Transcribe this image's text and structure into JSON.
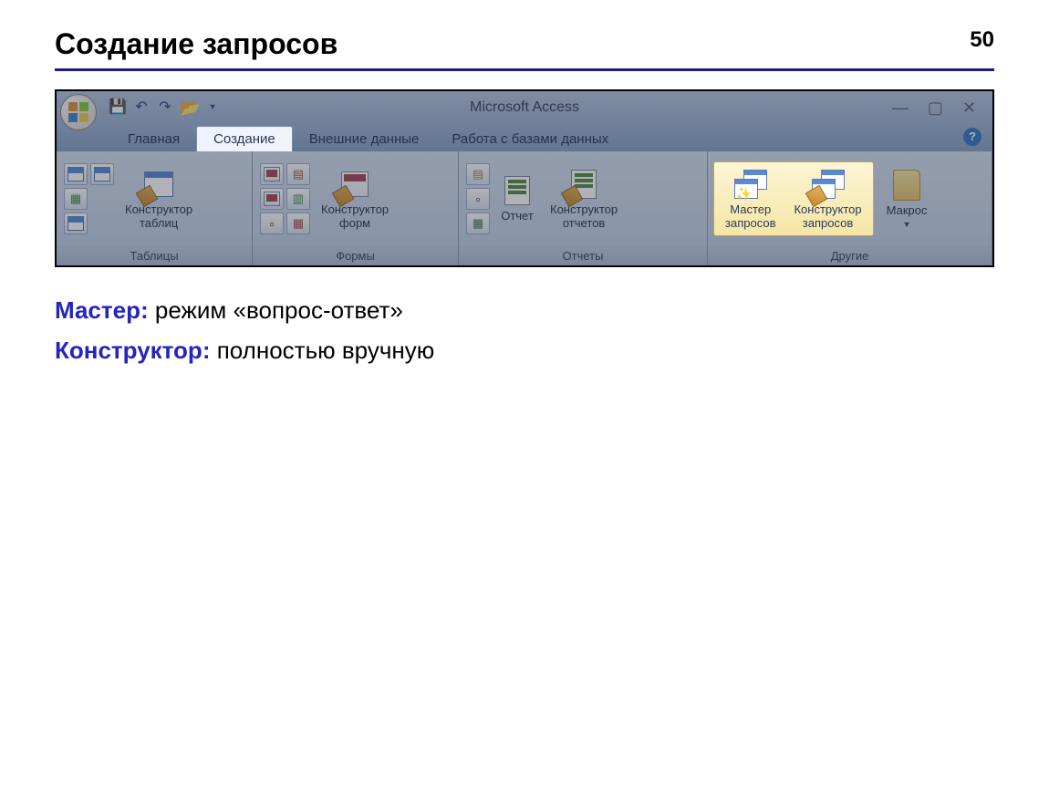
{
  "slide": {
    "title": "Создание запросов",
    "page": "50"
  },
  "app_title": "Microsoft Access",
  "tabs": {
    "home": "Главная",
    "create": "Создание",
    "external": "Внешние данные",
    "dbtools": "Работа с базами данных"
  },
  "groups": {
    "tables": {
      "label": "Таблицы",
      "designer": "Конструктор\nтаблиц"
    },
    "forms": {
      "label": "Формы",
      "designer": "Конструктор\nформ"
    },
    "reports": {
      "label": "Отчеты",
      "report": "Отчет",
      "designer": "Конструктор\nотчетов"
    },
    "other": {
      "label": "Другие",
      "wizard": "Мастер\nзапросов",
      "designer": "Конструктор\nзапросов",
      "macro": "Макрос"
    }
  },
  "descriptions": {
    "wizard_term": "Мастер:",
    "wizard_text": " режим «вопрос-ответ»",
    "designer_term": "Конструктор:",
    "designer_text": " полностью вручную"
  }
}
